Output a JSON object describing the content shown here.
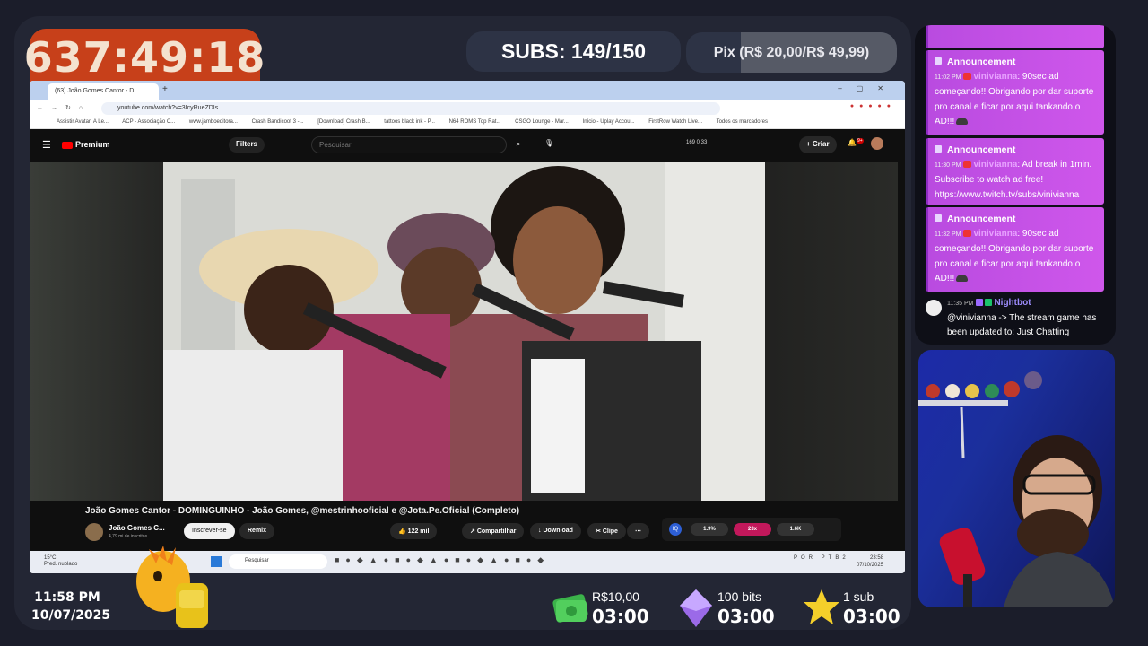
{
  "overlay": {
    "uptime": "637:49:18",
    "subs_goal": "SUBS: 149/150",
    "pix_goal": "Pix (R$ 20,00/R$ 49,99)",
    "pix_progress": 0.26,
    "clock_time": "11:58 PM",
    "clock_date": "10/07/2025",
    "alerts": [
      {
        "amount": "R$10,00",
        "countdown": "03:00",
        "icon": "money-icon"
      },
      {
        "amount": "100 bits",
        "countdown": "03:00",
        "icon": "bits-gem-icon"
      },
      {
        "amount": "1 sub",
        "countdown": "03:00",
        "icon": "star-icon"
      }
    ]
  },
  "browser": {
    "tab_title": "(63) João Gomes Cantor - D",
    "url": "youtube.com/watch?v=3IcyRueZDIs",
    "bookmarks": [
      "Assistir Avatar: A Le...",
      "ACP - Associação C...",
      "www.jamboeditora...",
      "Crash Bandicoot 3 -...",
      "[Download] Crash B...",
      "tattoos black ink - P...",
      "N64 ROMS Top Rat...",
      "CSGO Lounge - Mar...",
      "Início - Uplay Accou...",
      "FirstRow Watch Live..."
    ],
    "bookmarks_all": "Todos os marcadores"
  },
  "youtube": {
    "logo": "Premium",
    "filters": "Filters",
    "search_placeholder": "Pesquisar",
    "header_stats": "169  0  33",
    "create_label": "Criar",
    "notif_count": "9+",
    "video_title": "João Gomes Cantor - DOMINGUINHO - João Gomes, @mestrinhooficial e @Jota.Pe.Oficial (Completo)",
    "channel_name": "João Gomes C...",
    "channel_subs": "4,79 mi de inscritos",
    "subscribe": "Inscrever-se",
    "remix": "Remix",
    "likes": "122 mil",
    "share": "Compartilhar",
    "download": "Download",
    "clip": "Clipe",
    "iq": "IQ",
    "sb_values": [
      "1.9%",
      "23x",
      "1.6K"
    ]
  },
  "taskbar": {
    "weather_temp": "15°C",
    "weather_desc": "Pred. nublado",
    "search": "Pesquisar",
    "lang": "POR PTB2",
    "time": "23:58",
    "date": "07/10/2025"
  },
  "chat": {
    "announcements": [
      {
        "label": "Announcement",
        "time": "11:02 PM",
        "user": "vinivianna",
        "text": ": 90sec ad começando!! Obrigando por dar suporte pro canal e ficar por aqui tankando o AD!!!"
      },
      {
        "label": "Announcement",
        "time": "11:30 PM",
        "user": "vinivianna",
        "text": ": Ad break in 1min. Subscribe to watch ad free! https://www.twitch.tv/subs/vinivianna"
      },
      {
        "label": "Announcement",
        "time": "11:32 PM",
        "user": "vinivianna",
        "text": ": 90sec ad começando!! Obrigando por dar suporte pro canal e ficar por aqui tankando o AD!!!"
      }
    ],
    "bot": {
      "time": "11:35 PM",
      "name": "Nightbot",
      "text": "@vinivianna -> The stream game has been updated to: Just Chatting"
    }
  }
}
